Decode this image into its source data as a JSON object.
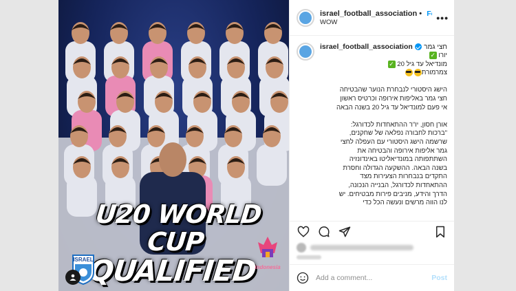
{
  "post": {
    "username": "israel_football_association",
    "follow_label": "Follow",
    "location": "WOW",
    "more_label": "•••"
  },
  "media": {
    "headline_line1": "U20 WORLD CUP",
    "headline_line2": "QUALIFIED",
    "logo_left_text": "ISRAEL",
    "logo_right_text": "indonesia"
  },
  "caption": {
    "username": "israel_football_association",
    "header_rtl": "חצי גמר",
    "lines": [
      "יורו",
      "מונדיאל עד גיל 20",
      "צמרמורת",
      "",
      "הישג היסטורי לנבחרת הנוער שהבטיחה",
      "חצי גמר באליפות אירופה וכרטיס ראשון",
      "אי פעם למונדיאל עד גיל 20 בשנה הבאה",
      "",
      "אורן חסון, יו\"ר ההתאחדות לכדורגל:",
      "\"ברכות לחבורה נפלאה של שחקנים,",
      "שרשמה הישג היסטורי עם העפלה לחצי",
      "גמר אליפות אירופה והבטיחה את",
      "השתתפותה במונדיאליטו באינדונזיה",
      "בשנה הבאה. ההשקעה הגדולה וחסרת",
      "התקדים בנבחרות הצעירות מצד",
      "ההתאחדות לכדורגל, הבנייה הנכונה,",
      "הדרך והידע, מניבים פירות מבטיחים. יש",
      "לנו הווה מרשים ונעשה הכל כדי"
    ]
  },
  "actions": {
    "like_icon": "heart-icon",
    "comment_icon": "comment-icon",
    "share_icon": "share-icon",
    "save_icon": "bookmark-icon"
  },
  "comment_box": {
    "placeholder": "Add a comment...",
    "post_label": "Post"
  },
  "colors": {
    "link_blue": "#0095f6",
    "disabled_blue": "#b2dffc",
    "text": "#262626",
    "secondary_text": "#8e8e8e"
  }
}
